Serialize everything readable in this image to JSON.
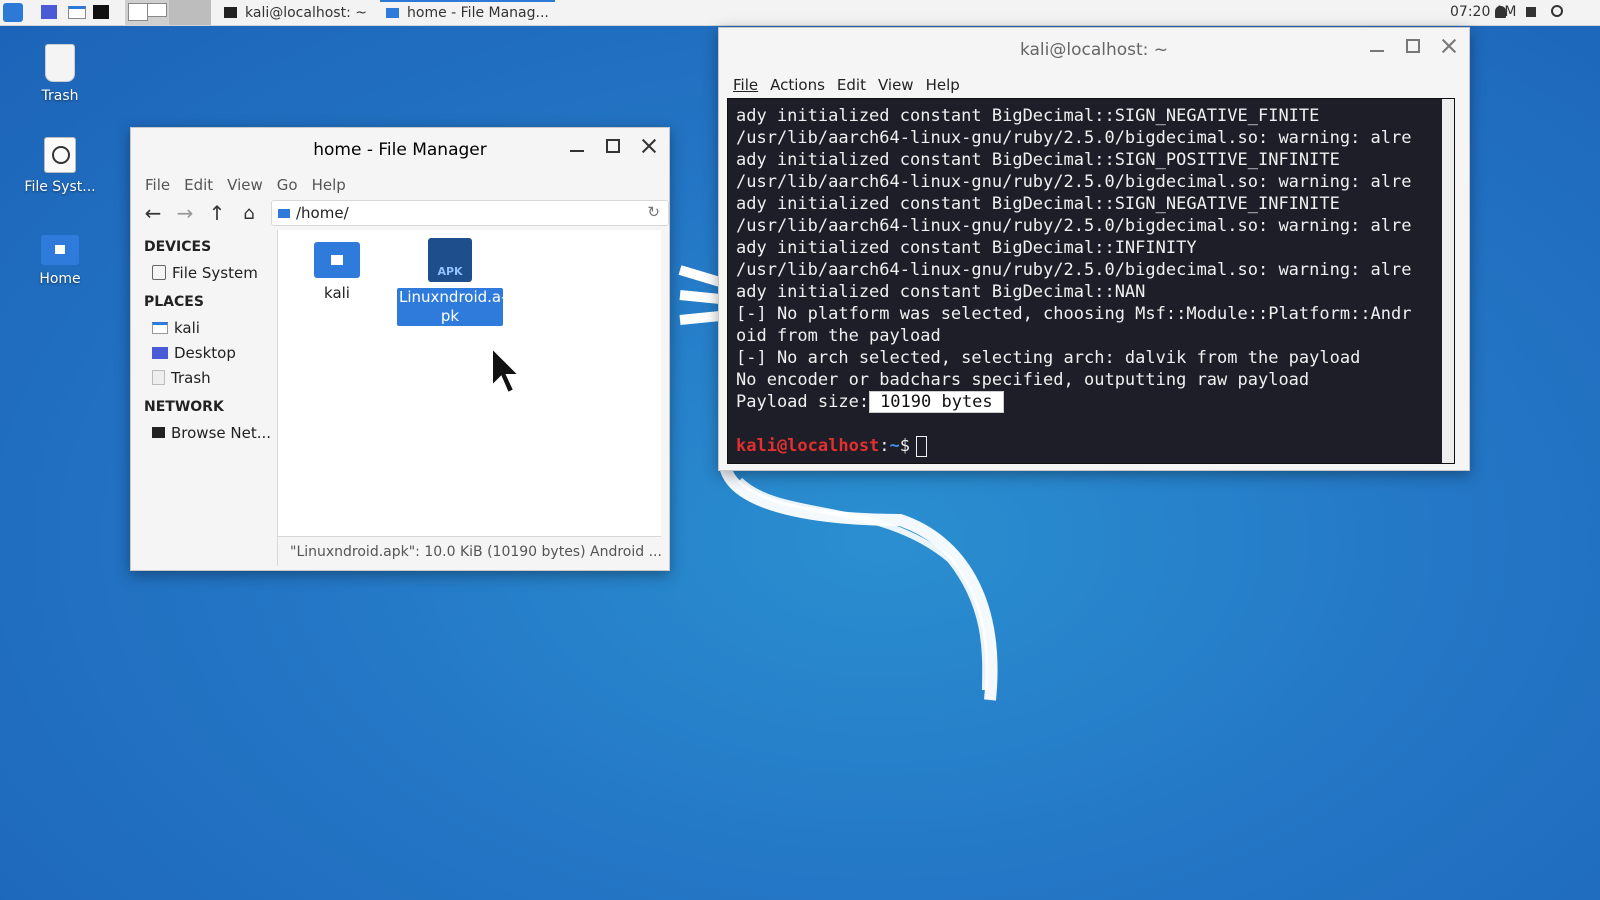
{
  "panel": {
    "tasks": [
      {
        "label": "kali@localhost: ~",
        "active": false
      },
      {
        "label": "home - File Manag...",
        "active": true
      }
    ],
    "clock": "07:20 AM"
  },
  "desktop": {
    "icons": [
      {
        "label": "Trash"
      },
      {
        "label": "File Syst..."
      },
      {
        "label": "Home"
      }
    ]
  },
  "file_manager": {
    "title": "home - File Manager",
    "menu": [
      "File",
      "Edit",
      "View",
      "Go",
      "Help"
    ],
    "path": "/home/",
    "sidebar": {
      "devices_header": "DEVICES",
      "devices": [
        "File System"
      ],
      "places_header": "PLACES",
      "places": [
        "kali",
        "Desktop",
        "Trash"
      ],
      "network_header": "NETWORK",
      "network": [
        "Browse Net..."
      ]
    },
    "files": [
      {
        "name": "kali",
        "icon": "home-folder-icon",
        "selected": false
      },
      {
        "name": "Linuxndroid.a-\npk",
        "icon_label": "APK",
        "selected": true
      }
    ],
    "status": "\"Linuxndroid.apk\": 10.0 KiB (10190 bytes) Android ..."
  },
  "terminal": {
    "title": "kali@localhost: ~",
    "menu": [
      "File",
      "Actions",
      "Edit",
      "View",
      "Help"
    ],
    "lines": [
      "ady initialized constant BigDecimal::SIGN_NEGATIVE_FINITE",
      "/usr/lib/aarch64-linux-gnu/ruby/2.5.0/bigdecimal.so: warning: alre",
      "ady initialized constant BigDecimal::SIGN_POSITIVE_INFINITE",
      "/usr/lib/aarch64-linux-gnu/ruby/2.5.0/bigdecimal.so: warning: alre",
      "ady initialized constant BigDecimal::SIGN_NEGATIVE_INFINITE",
      "/usr/lib/aarch64-linux-gnu/ruby/2.5.0/bigdecimal.so: warning: alre",
      "ady initialized constant BigDecimal::INFINITY",
      "/usr/lib/aarch64-linux-gnu/ruby/2.5.0/bigdecimal.so: warning: alre",
      "ady initialized constant BigDecimal::NAN",
      "[-] No platform was selected, choosing Msf::Module::Platform::Andr",
      "oid from the payload",
      "[-] No arch selected, selecting arch: dalvik from the payload",
      "No encoder or badchars specified, outputting raw payload"
    ],
    "payload_label": "Payload size:",
    "payload_value": "10190 bytes",
    "prompt_user": "kali@localhost",
    "prompt_sep": ":",
    "prompt_path": "~",
    "prompt_symbol": "$"
  },
  "colors": {
    "accent": "#2f7bdc",
    "prompt_user": "#e0302f",
    "prompt_path": "#3f8ff0"
  }
}
